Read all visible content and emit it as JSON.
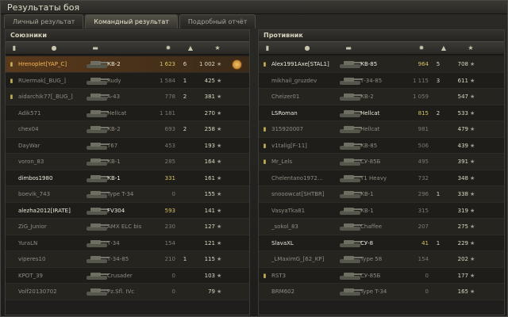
{
  "window": {
    "title": "Результаты боя"
  },
  "tabs": [
    {
      "label": "Личный результат",
      "active": false
    },
    {
      "label": "Командный результат",
      "active": true
    },
    {
      "label": "Подробный отчёт",
      "active": false
    }
  ],
  "allies": {
    "title": "Союзники",
    "rows": [
      {
        "name": "Hrenoplet[YAP_C]",
        "vehicle": "КВ-2",
        "damage": "1 623",
        "kills": "6",
        "xp": "1 002",
        "platoon": true,
        "alive": true,
        "self": true,
        "medal": true,
        "dmg_hi": true
      },
      {
        "name": "RUermak[_BUG_]",
        "vehicle": "Rudy",
        "damage": "1 584",
        "kills": "1",
        "xp": "425",
        "platoon": true,
        "alive": false
      },
      {
        "name": "aidarchik77[_BUG_]",
        "vehicle": "A-43",
        "damage": "778",
        "kills": "2",
        "xp": "381",
        "platoon": true,
        "alive": false
      },
      {
        "name": "Adik571",
        "vehicle": "Hellcat",
        "damage": "1 181",
        "kills": "",
        "xp": "270",
        "alive": false
      },
      {
        "name": "chex04",
        "vehicle": "КВ-2",
        "damage": "693",
        "kills": "2",
        "xp": "258",
        "alive": false
      },
      {
        "name": "DayWar",
        "vehicle": "T67",
        "damage": "453",
        "kills": "",
        "xp": "193",
        "alive": false
      },
      {
        "name": "voron_83",
        "vehicle": "КВ-1",
        "damage": "285",
        "kills": "",
        "xp": "164",
        "alive": false
      },
      {
        "name": "dimbos1980",
        "vehicle": "КВ-1",
        "damage": "331",
        "kills": "",
        "xp": "161",
        "alive": true,
        "dmg_hi": true
      },
      {
        "name": "boevik_743",
        "vehicle": "Type T-34",
        "damage": "0",
        "kills": "",
        "xp": "155",
        "alive": false
      },
      {
        "name": "alezha2012[IRATE]",
        "vehicle": "FV304",
        "damage": "593",
        "kills": "",
        "xp": "141",
        "alive": true,
        "dmg_hi": true
      },
      {
        "name": "ZiG_Junior",
        "vehicle": "AMX ELC bis",
        "damage": "230",
        "kills": "",
        "xp": "127",
        "alive": false
      },
      {
        "name": "YuraLN",
        "vehicle": "Т-34",
        "damage": "154",
        "kills": "",
        "xp": "121",
        "alive": false
      },
      {
        "name": "viperes10",
        "vehicle": "Т-34-85",
        "damage": "210",
        "kills": "1",
        "xp": "115",
        "alive": false
      },
      {
        "name": "KPOT_39",
        "vehicle": "Crusader",
        "damage": "0",
        "kills": "",
        "xp": "103",
        "alive": false
      },
      {
        "name": "Volf20130702",
        "vehicle": "Pz.Sfl. IVc",
        "damage": "0",
        "kills": "",
        "xp": "79",
        "alive": false
      }
    ]
  },
  "enemies": {
    "title": "Противник",
    "rows": [
      {
        "name": "Alex1991Axe[STAL1]",
        "vehicle": "КВ-85",
        "damage": "964",
        "kills": "5",
        "xp": "708",
        "platoon": true,
        "alive": true,
        "dmg_hi": true
      },
      {
        "name": "mikhail_gruzdev",
        "vehicle": "Т-34-85",
        "damage": "1 115",
        "kills": "3",
        "xp": "611",
        "alive": false
      },
      {
        "name": "Cheizer01",
        "vehicle": "КВ-2",
        "damage": "1 059",
        "kills": "",
        "xp": "547",
        "alive": false
      },
      {
        "name": "LSRoman",
        "vehicle": "Hellcat",
        "damage": "815",
        "kills": "2",
        "xp": "533",
        "alive": true,
        "dmg_hi": true
      },
      {
        "name": "315920007",
        "vehicle": "Hellcat",
        "damage": "981",
        "kills": "",
        "xp": "479",
        "platoon": true,
        "alive": false
      },
      {
        "name": "v1talig[F-11]",
        "vehicle": "КВ-85",
        "damage": "506",
        "kills": "",
        "xp": "439",
        "platoon": true,
        "alive": false
      },
      {
        "name": "Mr_Lels",
        "vehicle": "СУ-85Б",
        "damage": "495",
        "kills": "",
        "xp": "391",
        "platoon": true,
        "alive": false
      },
      {
        "name": "Chelentano1972...",
        "vehicle": "T1 Heavy",
        "damage": "732",
        "kills": "",
        "xp": "348",
        "alive": false
      },
      {
        "name": "snooowcat[SHTBR]",
        "vehicle": "КВ-1",
        "damage": "296",
        "kills": "1",
        "xp": "338",
        "alive": false
      },
      {
        "name": "VasyaTka81",
        "vehicle": "КВ-1",
        "damage": "315",
        "kills": "",
        "xp": "319",
        "alive": false
      },
      {
        "name": "_sokol_83",
        "vehicle": "Chaffee",
        "damage": "207",
        "kills": "",
        "xp": "275",
        "alive": false
      },
      {
        "name": "SlavaXL",
        "vehicle": "СУ-8",
        "damage": "41",
        "kills": "1",
        "xp": "229",
        "alive": true,
        "dmg_hi": true
      },
      {
        "name": "_LMaximG_[62_KP]",
        "vehicle": "Type 58",
        "damage": "154",
        "kills": "",
        "xp": "202",
        "alive": false
      },
      {
        "name": "RST3",
        "vehicle": "СУ-85Б",
        "damage": "0",
        "kills": "",
        "xp": "177",
        "platoon": true,
        "alive": false
      },
      {
        "name": "BRM602",
        "vehicle": "Type T-34",
        "damage": "0",
        "kills": "",
        "xp": "165",
        "alive": false
      }
    ]
  },
  "icons": {
    "platoon": "platoon-badge-icon",
    "player_column": "player-column-icon",
    "tank_column": "tank-column-icon",
    "damage_column": "damage-column-icon",
    "kills_column": "kills-column-icon",
    "xp_column": "xp-column-icon",
    "medal": "medal-icon"
  }
}
